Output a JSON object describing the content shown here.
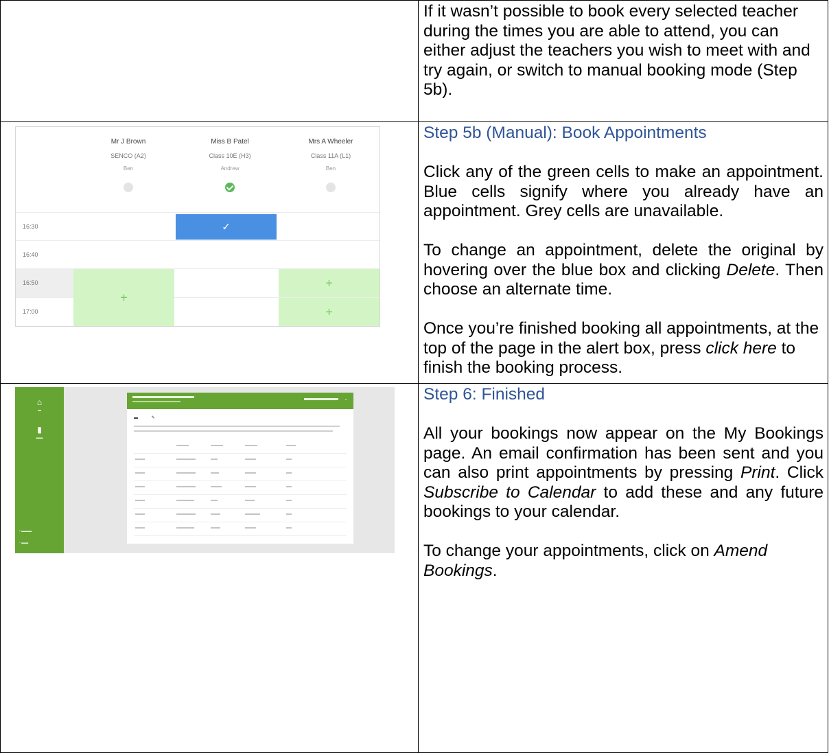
{
  "row1": {
    "text": "If it wasn’t possible to book every selected teacher during the times you are able to attend, you can either adjust the teachers you wish to meet with and try again, or switch to manual booking mode (Step 5b)."
  },
  "row2": {
    "heading": "Step 5b (Manual): Book Appointments",
    "p1": "Click any of the green cells to make an appointment. Blue cells signify where you already have an appointment. Grey cells are unavailable.",
    "p2_before": "To change an appointment, delete the original by hovering over the blue box and clicking ",
    "p2_em": "Delete",
    "p2_after": ". Then choose an alternate time.",
    "p3_before": "Once you’re finished booking all appointments, at the top of the page in the alert box, press ",
    "p3_em": "click here",
    "p3_after": " to finish the booking process.",
    "grid": {
      "teachers": [
        {
          "name": "Mr J Brown",
          "class": "SENCO (A2)",
          "pupil": "Ben",
          "selected": false
        },
        {
          "name": "Miss B Patel",
          "class": "Class 10E (H3)",
          "pupil": "Andrew",
          "selected": true
        },
        {
          "name": "Mrs A Wheeler",
          "class": "Class 11A (L1)",
          "pupil": "Ben",
          "selected": false
        }
      ],
      "times": [
        "16:30",
        "16:40",
        "16:50",
        "17:00"
      ],
      "icons": {
        "booked": "check-icon",
        "available": "plus-icon"
      }
    }
  },
  "row3": {
    "heading": "Step 6: Finished",
    "p1_a": "All your bookings now appear on the My Bookings page. An email confirmation has been sent and you can also print appointments by pressing ",
    "p1_em1": "Print",
    "p1_b": ". Click ",
    "p1_em2": "Subscribe to Calendar",
    "p1_c": " to add these and any future bookings to your calendar.",
    "p2_before": "To change your appointments, click on ",
    "p2_em": "Amend Bookings",
    "p2_after": ".",
    "colors": {
      "brand_green": "#66a534"
    }
  }
}
